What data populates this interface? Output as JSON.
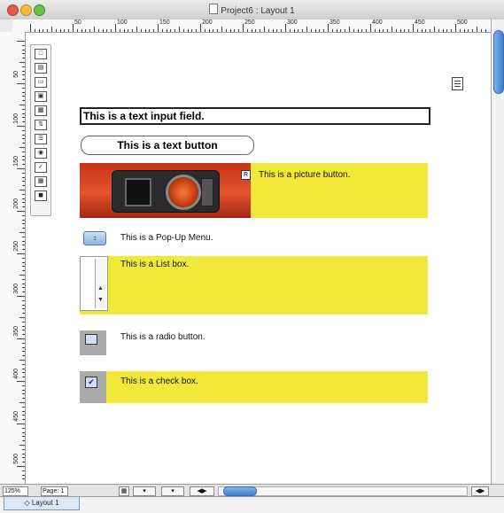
{
  "window": {
    "title": "Project6 : Layout 1"
  },
  "ruler": {
    "h_labels": [
      "50",
      "100",
      "150",
      "200",
      "250",
      "300",
      "350",
      "400",
      "450",
      "500"
    ],
    "v_labels": [
      "50",
      "100",
      "150",
      "200",
      "250",
      "300",
      "350",
      "400",
      "450",
      "500"
    ]
  },
  "toolbox": {
    "tools": [
      "text-input-tool",
      "text-button-tool",
      "label-tool",
      "picture-tool",
      "picture-button-tool",
      "popup-tool",
      "listbox-tool",
      "radio-tool",
      "checkbox-tool",
      "grid-tool",
      "image-tool"
    ]
  },
  "canvas": {
    "text_input_value": "This is a text input field.",
    "text_button_label": "This is a text button",
    "picture_button_label": "This is a picture button.",
    "popup_label": "This is a Pop-Up Menu.",
    "listbox_label": "This is a List box.",
    "radio_label": "This is a radio button.",
    "checkbox_label": "This is a check box.",
    "popup_glyph": "↕",
    "checkbox_glyph": "✔",
    "picture_badge": "R"
  },
  "status": {
    "zoom": "125%",
    "page": "Page: 1"
  },
  "tabs": [
    {
      "label": "Layout 1"
    }
  ],
  "colors": {
    "panel_yellow": "#f1e839",
    "gray_box": "#aaaaaa",
    "scroll_blue": "#3f7fd0"
  },
  "icons": {
    "close": "close-icon",
    "minimize": "minimize-icon",
    "zoom": "zoom-icon",
    "document": "document-icon",
    "layout-properties": "layout-properties-icon"
  }
}
